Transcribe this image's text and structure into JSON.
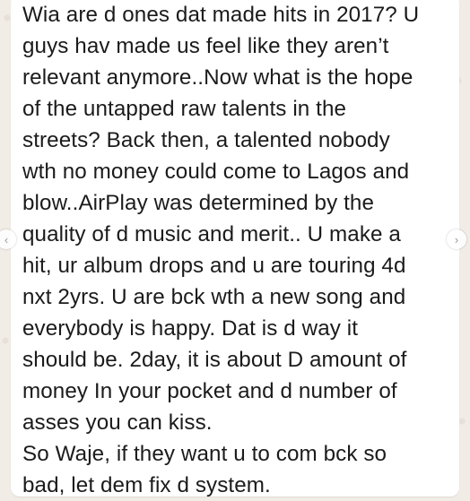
{
  "message": {
    "lines": [
      "Wia are d ones dat made hits in 2017? U",
      "guys hav made us feel like they aren’t",
      "relevant anymore..Now what is the hope",
      "of the untapped raw talents in the",
      "streets? Back then, a talented nobody",
      "wth no money could come to Lagos and",
      "blow..AirPlay was determined by the",
      "quality of d music and merit.. U make a",
      "hit, ur album drops and u are touring 4d",
      "nxt 2yrs. U are bck wth a new song and",
      "everybody is happy. Dat is d way it",
      "should be. 2day, it is about D amount of",
      "money In your pocket and d number of",
      "asses you can kiss.",
      "So Waje, if they want u to com bck so",
      "bad, let dem fix d system."
    ]
  },
  "navigation": {
    "prev_icon": "chevron-left-icon",
    "next_icon": "chevron-right-icon",
    "prev_glyph": "‹",
    "next_glyph": "›"
  },
  "colors": {
    "background": "#f1ece6",
    "bubble": "#ffffff",
    "text": "#1b1b1b"
  }
}
